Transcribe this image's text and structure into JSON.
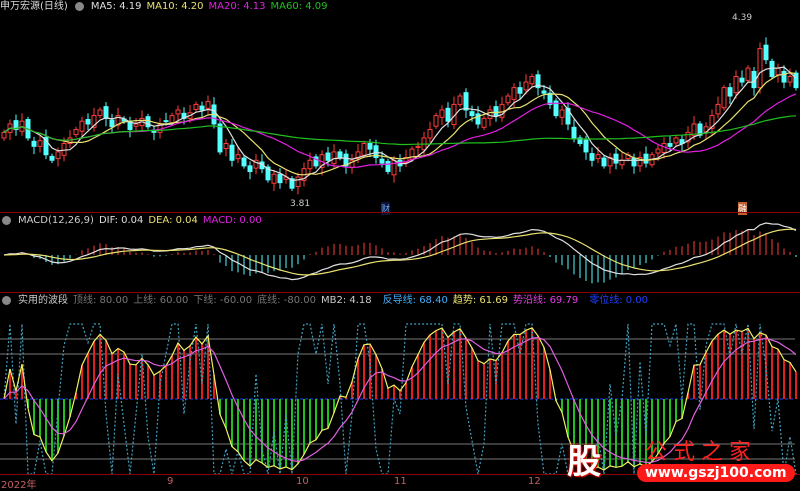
{
  "main_panel": {
    "stock": "申万宏源(日线)",
    "ma": [
      {
        "label": "MA5: 4.19",
        "color": "#e0e0e0"
      },
      {
        "label": "MA10: 4.20",
        "color": "#e8e070"
      },
      {
        "label": "MA20: 4.13",
        "color": "#e020e0"
      },
      {
        "label": "MA60: 4.09",
        "color": "#20c020"
      }
    ],
    "high_label": "4.39",
    "low_label": "3.81",
    "event_marks": [
      "财",
      "融"
    ]
  },
  "macd_panel": {
    "title": "MACD(12,26,9)",
    "dif": "DIF: 0.04",
    "dea": "DEA: 0.04",
    "macd": "MACD: 0.00"
  },
  "osc_panel": {
    "title": "实用的波段",
    "params": [
      "顶线: 80.00",
      "上线: 60.00",
      "下线: -60.00",
      "底线: -80.00",
      "MB2: 4.18"
    ],
    "fandao": "反导线: 68.40",
    "trend": "趋势: 61.69",
    "trend_line": "势沿线: 69.79",
    "zero": "零位线: 0.00",
    "levels": [
      80,
      60,
      -60,
      -80
    ]
  },
  "x_axis": [
    "2022年",
    "9",
    "10",
    "11",
    "12"
  ],
  "watermark": {
    "char": "股",
    "title": "公式之家",
    "url": "www.gszj100.com"
  },
  "colors": {
    "up": "#ff3c3c",
    "down": "#54ffff",
    "bg": "#000000",
    "border": "#8b0000"
  },
  "chart_data": {
    "type": "candlestick",
    "closes": [
      4.02,
      4.05,
      4.03,
      4.06,
      4.0,
      3.97,
      3.99,
      3.94,
      3.92,
      3.95,
      3.98,
      4.0,
      4.03,
      4.06,
      4.05,
      4.08,
      4.1,
      4.07,
      4.04,
      4.08,
      4.06,
      4.03,
      4.05,
      4.07,
      4.04,
      4.02,
      4.05,
      4.06,
      4.08,
      4.1,
      4.07,
      4.09,
      4.12,
      4.1,
      4.13,
      4.05,
      3.95,
      3.98,
      3.92,
      3.94,
      3.9,
      3.88,
      3.92,
      3.89,
      3.85,
      3.87,
      3.84,
      3.86,
      3.82,
      3.86,
      3.89,
      3.92,
      3.9,
      3.94,
      3.92,
      3.95,
      3.93,
      3.9,
      3.92,
      3.95,
      3.98,
      3.96,
      3.93,
      3.91,
      3.88,
      3.92,
      3.9,
      3.93,
      3.96,
      3.97,
      4.0,
      4.03,
      4.08,
      4.1,
      4.06,
      4.12,
      4.15,
      4.1,
      4.08,
      4.05,
      4.07,
      4.1,
      4.08,
      4.12,
      4.15,
      4.18,
      4.16,
      4.2,
      4.22,
      4.18,
      4.16,
      4.12,
      4.08,
      4.1,
      4.05,
      4.0,
      3.98,
      3.95,
      3.92,
      3.94,
      3.9,
      3.93,
      3.91,
      3.92,
      3.94,
      3.9,
      3.93,
      3.91,
      3.94,
      3.96,
      3.98,
      3.97,
      4.0,
      3.98,
      4.02,
      4.05,
      4.01,
      4.04,
      4.08,
      4.12,
      4.18,
      4.15,
      4.22,
      4.2,
      4.25,
      4.18,
      4.32,
      4.28,
      4.22,
      4.25,
      4.2,
      4.22,
      4.18
    ],
    "price_range": [
      3.76,
      4.44
    ]
  }
}
